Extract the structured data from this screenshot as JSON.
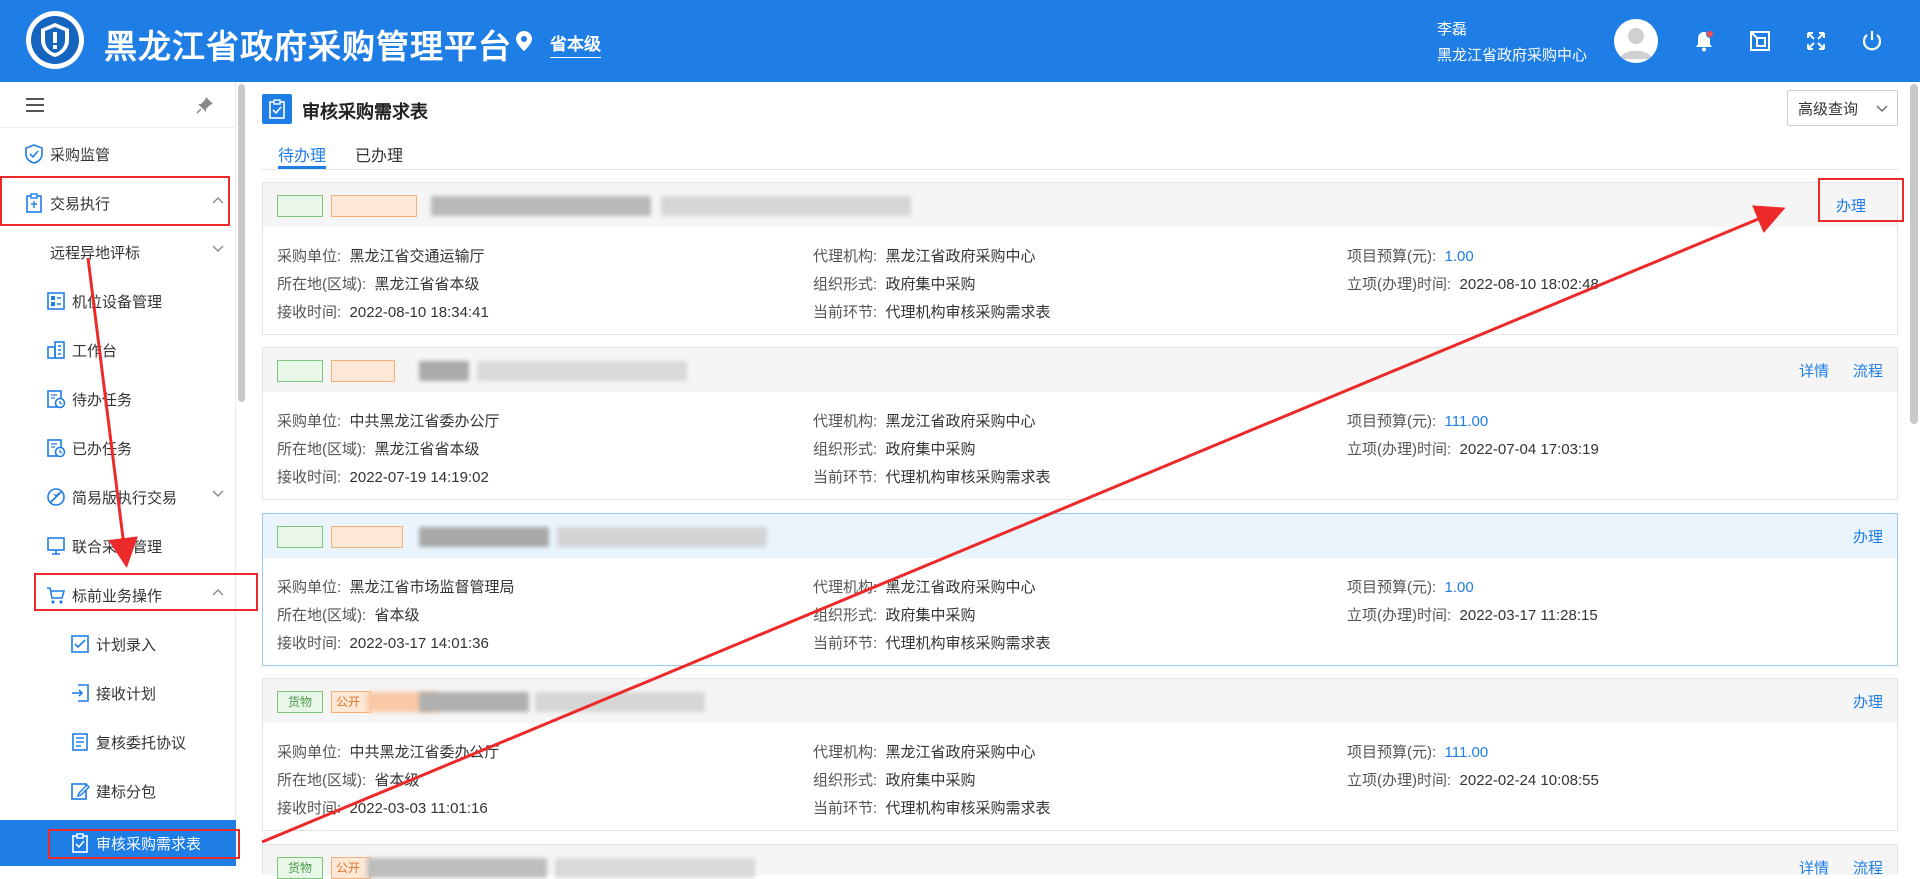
{
  "header": {
    "title": "黑龙江省政府采购管理平台",
    "location": "省本级",
    "user_name": "李磊",
    "user_org": "黑龙江省政府采购中心"
  },
  "sidebar": {
    "items": [
      {
        "label": "采购监管",
        "icon": "shield-icon"
      },
      {
        "label": "交易执行",
        "icon": "clipboard-icon"
      },
      {
        "label": "远程异地评标",
        "icon": ""
      },
      {
        "label": "机位设备管理",
        "icon": "device-icon"
      },
      {
        "label": "工作台",
        "icon": "building-icon"
      },
      {
        "label": "待办任务",
        "icon": "task-icon"
      },
      {
        "label": "已办任务",
        "icon": "task-done-icon"
      },
      {
        "label": "简易版执行交易",
        "icon": "no-entry-icon"
      },
      {
        "label": "联合采购管理",
        "icon": "monitor-icon"
      },
      {
        "label": "标前业务操作",
        "icon": "cart-icon"
      },
      {
        "label": "计划录入",
        "icon": "checklist-icon"
      },
      {
        "label": "接收计划",
        "icon": "login-icon"
      },
      {
        "label": "复核委托协议",
        "icon": "document-icon"
      },
      {
        "label": "建标分包",
        "icon": "edit-icon"
      },
      {
        "label": "审核采购需求表",
        "icon": "clipboard-check-icon"
      }
    ]
  },
  "main": {
    "title": "审核采购需求表",
    "advanced_search": "高级查询",
    "tabs": [
      {
        "label": "待办理"
      },
      {
        "label": "已办理"
      }
    ],
    "field_labels": {
      "unit": "采购单位:",
      "region": "所在地(区域):",
      "received": "接收时间:",
      "agency": "代理机构:",
      "form": "组织形式:",
      "stage": "当前环节:",
      "budget": "项目预算(元):",
      "approved": "立项(办理)时间:"
    },
    "cards": [
      {
        "actions": [
          "办理"
        ],
        "unit": "黑龙江省交通运输厅",
        "region": "黑龙江省省本级",
        "received": "2022-08-10 18:34:41",
        "agency": "黑龙江省政府采购中心",
        "form": "政府集中采购",
        "stage": "代理机构审核采购需求表",
        "budget": "1.00",
        "approved": "2022-08-10 18:02:48"
      },
      {
        "actions": [
          "详情",
          "流程"
        ],
        "unit": "中共黑龙江省委办公厅",
        "region": "黑龙江省省本级",
        "received": "2022-07-19 14:19:02",
        "agency": "黑龙江省政府采购中心",
        "form": "政府集中采购",
        "stage": "代理机构审核采购需求表",
        "budget": "111.00",
        "approved": "2022-07-04 17:03:19"
      },
      {
        "actions": [
          "办理"
        ],
        "unit": "黑龙江省市场监督管理局",
        "region": "省本级",
        "received": "2022-03-17 14:01:36",
        "agency": "黑龙江省政府采购中心",
        "form": "政府集中采购",
        "stage": "代理机构审核采购需求表",
        "budget": "1.00",
        "approved": "2022-03-17 11:28:15"
      },
      {
        "actions": [
          "办理"
        ],
        "tag_green": "货物",
        "tag_orange": "公开",
        "unit": "中共黑龙江省委办公厅",
        "region": "省本级",
        "received": "2022-03-03 11:01:16",
        "agency": "黑龙江省政府采购中心",
        "form": "政府集中采购",
        "stage": "代理机构审核采购需求表",
        "budget": "111.00",
        "approved": "2022-02-24 10:08:55"
      },
      {
        "actions": [
          "详情",
          "流程"
        ],
        "tag_green": "货物",
        "tag_orange": "公开"
      }
    ]
  },
  "colors": {
    "brand": "#1e7ee6",
    "annotation_red": "#ec2a2a"
  }
}
